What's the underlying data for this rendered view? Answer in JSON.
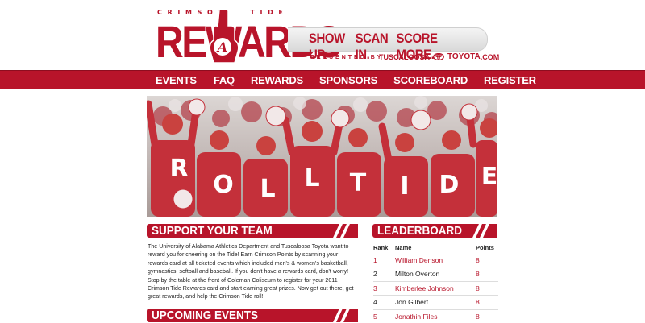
{
  "logo": {
    "crimson_tide_letters": [
      "C",
      "R",
      "I",
      "M",
      "S",
      "O",
      "N",
      "",
      "T",
      "I",
      "D",
      "E"
    ],
    "rewards_text": "REWARDS",
    "finger_letter": "A"
  },
  "tagline": {
    "items": [
      "SHOW UP.",
      "SCAN IN.",
      "SCORE MORE."
    ],
    "presented_by": "PRESENTED BY",
    "sponsor_prefix": "TUSCALOOSA",
    "sponsor_name": "TOYOTA",
    "sponsor_suffix": ".COM"
  },
  "nav": {
    "items": [
      "EVENTS",
      "FAQ",
      "REWARDS",
      "SPONSORS",
      "SCOREBOARD",
      "REGISTER"
    ]
  },
  "hero": {
    "letters": [
      "R",
      "O",
      "L",
      "L",
      "T",
      "I",
      "D",
      "E"
    ]
  },
  "support": {
    "title": "SUPPORT YOUR TEAM",
    "body": "The University of Alabama Athletics Department and Tuscaloosa Toyota want to reward you for cheering on the Tide! Earn Crimson Points by scanning your rewards card at all ticketed events which included men's & women's basketball, gymnastics, softball and baseball. If you don't have a rewards card, don't worry! Stop by the table at the front of Coleman Coliseum to register for your 2011 Crimson Tide Rewards card and start earning great prizes. Now get out there, get great rewards, and help the Crimson Tide roll!"
  },
  "upcoming": {
    "title": "UPCOMING EVENTS"
  },
  "leaderboard": {
    "title": "LEADERBOARD",
    "headers": {
      "rank": "Rank",
      "name": "Name",
      "points": "Points"
    },
    "rows": [
      {
        "rank": "1",
        "name": "William Denson",
        "points": "8"
      },
      {
        "rank": "2",
        "name": "Milton Overton",
        "points": "8"
      },
      {
        "rank": "3",
        "name": "Kimberlee Johnson",
        "points": "8"
      },
      {
        "rank": "4",
        "name": "Jon Gilbert",
        "points": "8"
      },
      {
        "rank": "5",
        "name": "Jonathin Files",
        "points": "8"
      }
    ]
  },
  "colors": {
    "crimson": "#b8142a",
    "white": "#ffffff",
    "gray": "#d9d9d9"
  }
}
